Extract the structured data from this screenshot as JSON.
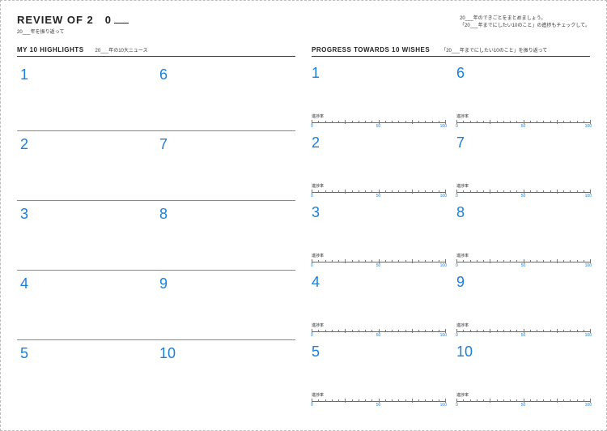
{
  "header": {
    "title_prefix": "REVIEW OF 2",
    "title_gap": "0",
    "subtitle": "20___年を振り返って",
    "right_line1": "20___年のできごとをまとめましょう。",
    "right_line2": "「20___年までにしたい10のこと」の進捗もチェックして。"
  },
  "left": {
    "title": "MY 10 HIGHLIGHTS",
    "sub": "20___年の10大ニュース",
    "nums": [
      "1",
      "2",
      "3",
      "4",
      "5",
      "6",
      "7",
      "8",
      "9",
      "10"
    ]
  },
  "right": {
    "title": "PROGRESS TOWARDS 10 WISHES",
    "sub": "「20___年までにしたい10のこと」を振り返って",
    "nums": [
      "1",
      "2",
      "3",
      "4",
      "5",
      "6",
      "7",
      "8",
      "9",
      "10"
    ],
    "scale_label": "進捗率",
    "scale_values": {
      "min": "0",
      "mid": "50",
      "max": "100"
    }
  }
}
